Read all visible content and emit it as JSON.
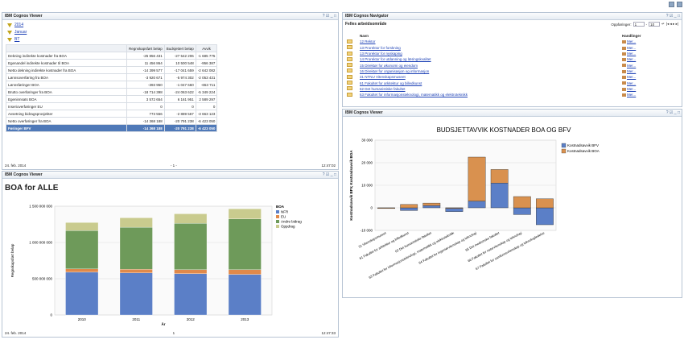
{
  "viewer_title": "IBM Cognos Viewer",
  "navigator_title": "IBM Cognos Navigator",
  "controls": "? ☑ _ □",
  "top_left": {
    "filters": [
      "2014",
      "Januar",
      "BT"
    ],
    "columns": [
      "",
      "Regnskapsført beløp",
      "Budsjettert beløp",
      "Avvik"
    ],
    "rows": [
      [
        "Dekning indirekte kostnader fra BOA",
        "-25 856 431",
        "-27 542 206",
        "-1 685 775"
      ],
      [
        "Egenandel indirekte kostnader til BOA",
        "11 456 864",
        "10 500 548",
        "-956 387"
      ],
      [
        "Netto dekning indirekte kostnader fra BOA",
        "-14 399 577",
        "-17 041 659",
        "-2 642 082"
      ],
      [
        "Lønnsoverføring fra BOA",
        "-3 920 671",
        "-5 974 302",
        "-2 053 431"
      ],
      [
        "Lønnsføringer BOA",
        "-393 950",
        "-1 047 660",
        "-653 711"
      ],
      [
        "Brutto overføringer fra BOA",
        "-18 714 398",
        "-24 063 622",
        "-5 349 224"
      ],
      [
        "Egeninnsats BOA",
        "3 572 654",
        "6 161 951",
        "2 589 297"
      ],
      [
        "Inserioverføringer EU",
        "0",
        "0",
        "0"
      ],
      [
        "Avsetning bidragsprosjekter",
        "773 556",
        "-2 889 567",
        "-3 663 123"
      ],
      [
        "Netto overføringer fra BOA",
        "-14 368 188",
        "-20 791 238",
        "-6 423 050"
      ]
    ],
    "total": [
      "Føringer BFV",
      "-14 368 188",
      "-20 791 238",
      "-6 423 050"
    ],
    "date": "24. feb. 2014",
    "page": "- 1 -",
    "time": "12:47:02"
  },
  "bottom_left": {
    "heading": "BOA for ALLE",
    "date": "24. feb. 2014",
    "page": "1",
    "time": "12:47:33"
  },
  "navigator": {
    "workspace": "Felles arbeidsområde",
    "entries_label": "Oppføringer:",
    "entries_from": "1",
    "entries_to": "10",
    "col_name": "Navn",
    "col_actions": "Handlinger",
    "action_label": "Mer...",
    "items": [
      "12 Rektor",
      "13 Prorektor for forskning",
      "13 Prorektor for nyskaping",
      "14 Prorektor for utdanning og læringskvalitet",
      "15 Direktør for økonomi og eiendom",
      "16 Direktør for organisasjon og informasjon",
      "31 NTNU Vitenskapsmuseet",
      "61 Fakultet for arkitektur og billedkunst",
      "62 Det humanistiske fakultet",
      "63 Fakultet for informasjonsteknologi, matematikk og elektroteknikk"
    ]
  },
  "chart_data": [
    {
      "type": "bar",
      "title": "BOA for ALLE",
      "ylabel": "Regnskapsført beløp",
      "xlabel": "År",
      "categories": [
        "2010",
        "2011",
        "2012",
        "2013"
      ],
      "ylim": [
        0,
        1500000000
      ],
      "yticks": [
        "0",
        "500 000 000",
        "1 000 000 000",
        "1 500 000 000"
      ],
      "legend_title": "BOA",
      "stacked": true,
      "series": [
        {
          "name": "NFR",
          "color": "#5b7fc7",
          "values": [
            590000000,
            580000000,
            570000000,
            560000000
          ]
        },
        {
          "name": "EU",
          "color": "#e0894a",
          "values": [
            45000000,
            50000000,
            55000000,
            65000000
          ]
        },
        {
          "name": "Andre bidrag",
          "color": "#6e9a5a",
          "values": [
            530000000,
            580000000,
            640000000,
            700000000
          ]
        },
        {
          "name": "Oppdrag",
          "color": "#c9cb8e",
          "values": [
            110000000,
            130000000,
            130000000,
            140000000
          ]
        }
      ]
    },
    {
      "type": "bar",
      "title": "BUDSJETTAVVIK KOSTNADER BOA OG BFV",
      "ylabel": "Kostnadsavvik BFV, Kostnadsavvik BOA",
      "ylim": [
        -10000,
        30000
      ],
      "yticks": [
        "-10 000",
        "0",
        "10 000",
        "20 000",
        "30 000"
      ],
      "categories": [
        "31 Vitenskapsmuseet",
        "61 Fakultet for arkitektur og billedkunst",
        "62 Det humanistiske fakultet",
        "63 Fakultet for informasjonsteknologi, matematikk og elektroteknikk",
        "64 Fakultet for ingeniørvitenskap og teknologi",
        "65 Det medisinske fakultet",
        "66 Fakultet for naturvitenskap og teknologi",
        "67 Fakultet for samfunnsvitenskap og teknologiledelse"
      ],
      "stacked": true,
      "series": [
        {
          "name": "Kostnadsavvik BFV",
          "color": "#5b7fc7",
          "values": [
            -300,
            -1200,
            1000,
            -1700,
            3000,
            11000,
            -3000,
            -7500
          ]
        },
        {
          "name": "Kostnadsavvik BOA",
          "color": "#d9914f",
          "values": [
            0,
            1500,
            1100,
            0,
            19500,
            6000,
            5000,
            4000
          ]
        }
      ]
    }
  ]
}
